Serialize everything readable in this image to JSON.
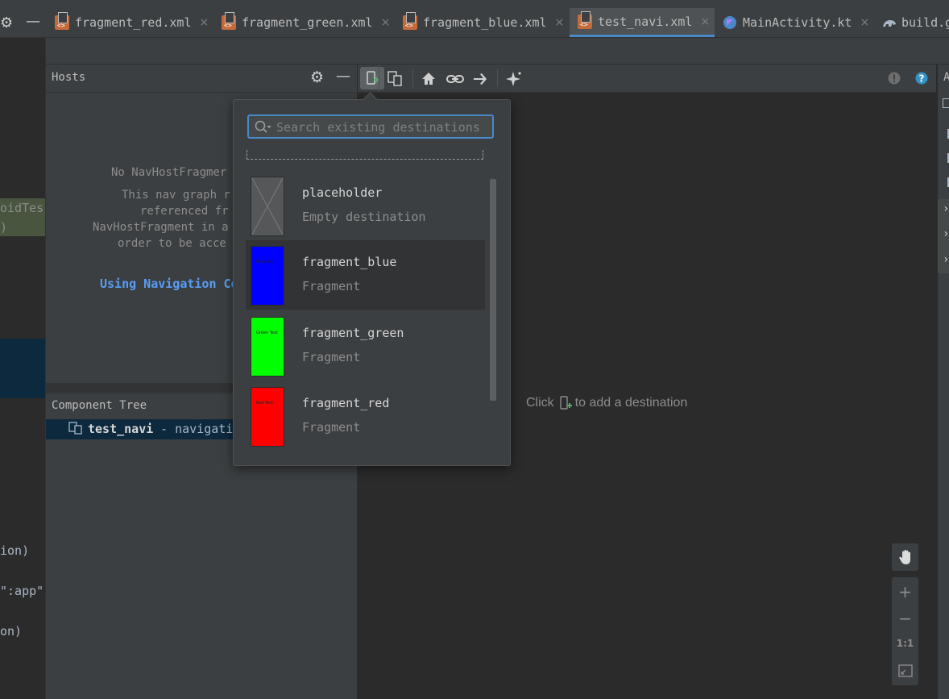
{
  "tabs": [
    {
      "label": "fragment_red.xml",
      "icon": "xml-file-icon",
      "active": false
    },
    {
      "label": "fragment_green.xml",
      "icon": "xml-file-icon",
      "active": false
    },
    {
      "label": "fragment_blue.xml",
      "icon": "xml-file-icon",
      "active": false
    },
    {
      "label": "test_navi.xml",
      "icon": "xml-file-icon",
      "active": true
    },
    {
      "label": "MainActivity.kt",
      "icon": "kotlin-file-icon",
      "active": false
    },
    {
      "label": "build.g",
      "icon": "gradle-icon",
      "active": false
    }
  ],
  "tab_close_glyph": "×",
  "editor_fragments": [
    "oidTes",
    ")",
    "ion)",
    "\":app\")",
    "on)"
  ],
  "hosts": {
    "title": "Hosts",
    "message_lines": [
      "No NavHostFragmer",
      "This nav graph r",
      "referenced fr",
      "NavHostFragment in a",
      "order to be acce"
    ],
    "link": "Using Navigation Co"
  },
  "component_tree": {
    "title": "Component Tree",
    "row_name": "test_navi",
    "row_desc": " - navigati"
  },
  "design": {
    "hint_prefix": "Click",
    "hint_suffix": "to add a destination"
  },
  "popup": {
    "search_placeholder": "Search existing destinations",
    "destinations": [
      {
        "name": "placeholder",
        "type": "Empty destination",
        "color": "#555758",
        "highlighted": false
      },
      {
        "name": "fragment_blue",
        "type": "Fragment",
        "color": "#0000ff",
        "highlighted": true,
        "thumb_text": "Blue Text"
      },
      {
        "name": "fragment_green",
        "type": "Fragment",
        "color": "#00ff00",
        "highlighted": false,
        "thumb_text": "Green Text"
      },
      {
        "name": "fragment_red",
        "type": "Fragment",
        "color": "#ff0000",
        "highlighted": false,
        "thumb_text": "Red Text"
      }
    ]
  },
  "zoom": {
    "one_to_one": "1:1"
  },
  "right_panel_letter": "A"
}
